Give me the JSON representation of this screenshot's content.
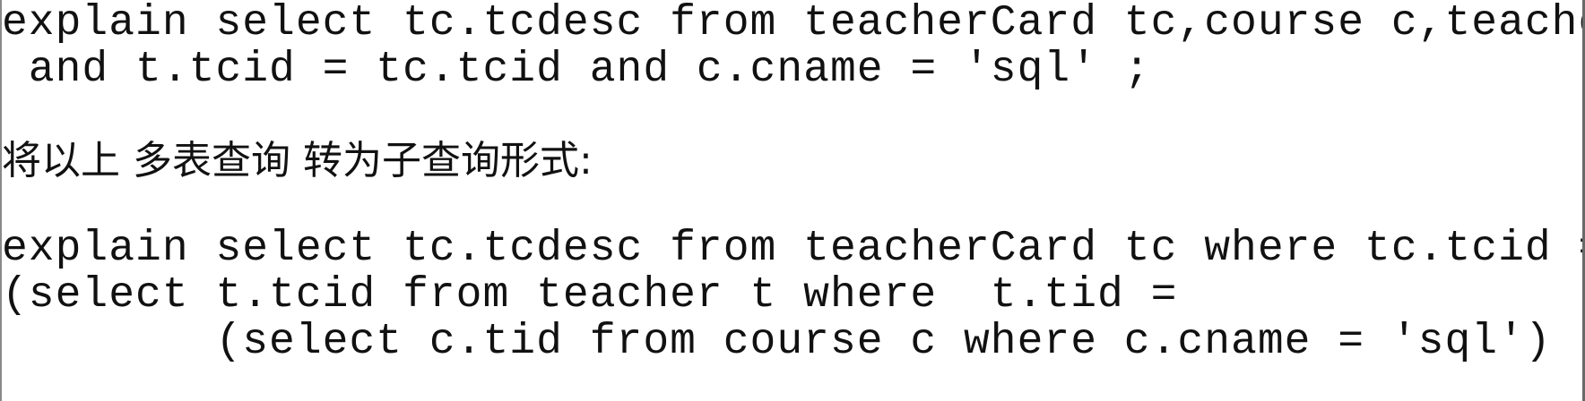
{
  "document": {
    "lines": [
      "explain select tc.tcdesc from teacherCard tc,course c,teache",
      " and t.tcid = tc.tcid and c.cname = 'sql' ;",
      "将以上 多表查询 转为子查询形式:",
      "explain select tc.tcdesc from teacherCard tc where tc.tcid =",
      "(select t.tcid from teacher t where  t.tid =",
      "        (select c.tid from course c where c.cname = 'sql')"
    ]
  }
}
